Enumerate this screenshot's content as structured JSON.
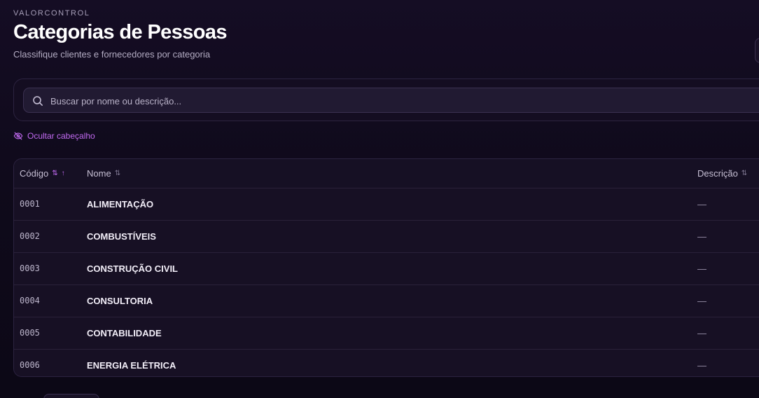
{
  "header": {
    "brand": "VALORCONTROL",
    "title": "Categorias de Pessoas",
    "subtitle": "Classifique clientes e fornecedores por categoria"
  },
  "search": {
    "placeholder": "Buscar por nome ou descrição...",
    "value": "",
    "icon": "search-icon"
  },
  "toggle_header": {
    "label": "Ocultar cabeçalho",
    "icon": "eye-off-icon"
  },
  "table": {
    "columns": [
      {
        "label": "Código",
        "sort_icon": "⇅",
        "sorted": "asc",
        "active": true
      },
      {
        "label": "Nome",
        "sort_icon": "⇅",
        "active": false
      },
      {
        "label": "Descrição",
        "sort_icon": "⇅",
        "active": false
      }
    ],
    "rows": [
      {
        "code": "0001",
        "name": "ALIMENTAÇÃO",
        "description": "—"
      },
      {
        "code": "0002",
        "name": "COMBUSTÍVEIS",
        "description": "—"
      },
      {
        "code": "0003",
        "name": "CONSTRUÇÃO CIVIL",
        "description": "—"
      },
      {
        "code": "0004",
        "name": "CONSULTORIA",
        "description": "—"
      },
      {
        "code": "0005",
        "name": "CONTABILIDADE",
        "description": "—"
      },
      {
        "code": "0006",
        "name": "ENERGIA ELÉTRICA",
        "description": "—"
      }
    ]
  },
  "colors": {
    "accent": "#c06af0",
    "background": "#0e0918",
    "panel": "#150e22",
    "border": "#2c2340"
  }
}
